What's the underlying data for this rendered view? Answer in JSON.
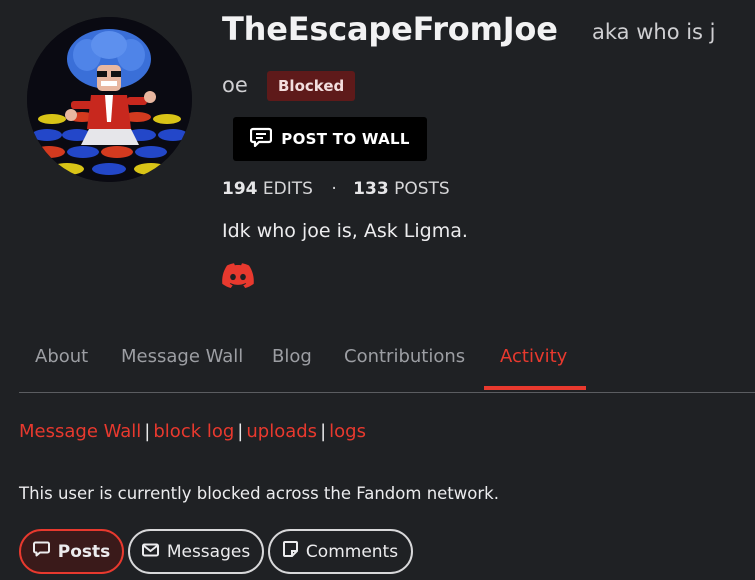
{
  "profile": {
    "username": "TheEscapeFromJoe",
    "aka_line1": "aka who is j",
    "aka_line2": "oe",
    "badge": "Blocked",
    "post_button": "POST TO WALL",
    "edits_count": "194",
    "edits_label": "EDITS",
    "separator": "·",
    "posts_count": "133",
    "posts_label": "POSTS",
    "bio": "Idk who joe is, Ask Ligma."
  },
  "tabs": [
    {
      "label": "About"
    },
    {
      "label": "Message Wall"
    },
    {
      "label": "Blog"
    },
    {
      "label": "Contributions"
    },
    {
      "label": "Activity",
      "active": true
    }
  ],
  "links": [
    {
      "label": "Message Wall"
    },
    {
      "label": "block log"
    },
    {
      "label": "uploads"
    },
    {
      "label": "logs"
    }
  ],
  "link_separator": "|",
  "notice": "This user is currently blocked across the Fandom network.",
  "filters": [
    {
      "label": "Posts",
      "icon": "speech-bubble-icon",
      "active": true
    },
    {
      "label": "Messages",
      "icon": "envelope-icon"
    },
    {
      "label": "Comments",
      "icon": "comment-page-icon"
    }
  ],
  "colors": {
    "accent": "#e8392e",
    "badge_bg": "#5e1a1a",
    "background": "#1f2124"
  }
}
